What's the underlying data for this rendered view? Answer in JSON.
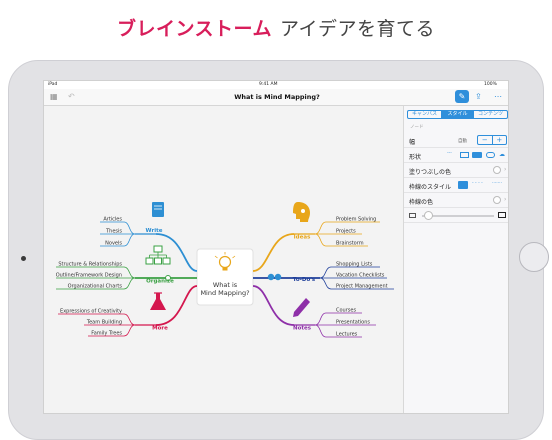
{
  "headline": {
    "accent": "ブレインストーム",
    "rest": "アイデアを育てる"
  },
  "status_bar": {
    "device": "iPad",
    "time": "9:41 AM",
    "battery": "100%"
  },
  "document": {
    "title": "What is Mind Mapping?"
  },
  "inspector": {
    "tabs": [
      {
        "label": "キャンバス",
        "active": false
      },
      {
        "label": "スタイル",
        "active": true
      },
      {
        "label": "コンテンツ",
        "active": false
      }
    ],
    "section_title": "ノード",
    "width_label": "幅",
    "width_value": "自動",
    "stepper_minus": "−",
    "stepper_plus": "+",
    "shape_label": "形状",
    "fill_color_label": "塗りつぶしの色",
    "border_style_label": "枠線のスタイル",
    "border_color_label": "枠線の色"
  },
  "mindmap": {
    "center": [
      "What is",
      "Mind Mapping?"
    ],
    "branches": [
      {
        "label": "Write",
        "color": "#2d8fd3",
        "leaves": [
          "Articles",
          "Thesis",
          "Novels"
        ]
      },
      {
        "label": "Organize",
        "color": "#3aa043",
        "leaves": [
          "Structure & Relationships",
          "Outline/Framework Design",
          "Organizational Charts"
        ]
      },
      {
        "label": "More",
        "color": "#d4174e",
        "leaves": [
          "Expressions of Creativity",
          "Team Building",
          "Family Trees"
        ]
      },
      {
        "label": "Ideas",
        "color": "#e8a61a",
        "leaves": [
          "Problem Solving",
          "Projects",
          "Brainstorm"
        ]
      },
      {
        "label": "To-Do's",
        "color": "#1f3f9a",
        "leaves": [
          "Shopping Lists",
          "Vacation Checklists",
          "Project Management"
        ]
      },
      {
        "label": "Notes",
        "color": "#8e2fa8",
        "leaves": [
          "Courses",
          "Presentations",
          "Lectures"
        ]
      }
    ]
  },
  "colors": {
    "accent": "#d81e5b",
    "ui_blue": "#2f8fdb"
  },
  "icons": [
    "grid-icon",
    "undo-icon",
    "pen-icon",
    "share-icon",
    "more-icon",
    "lightbulb-icon",
    "book-icon",
    "org-chart-icon",
    "flask-icon",
    "head-idea-icon",
    "checkbox-icon",
    "pencil-icon"
  ]
}
